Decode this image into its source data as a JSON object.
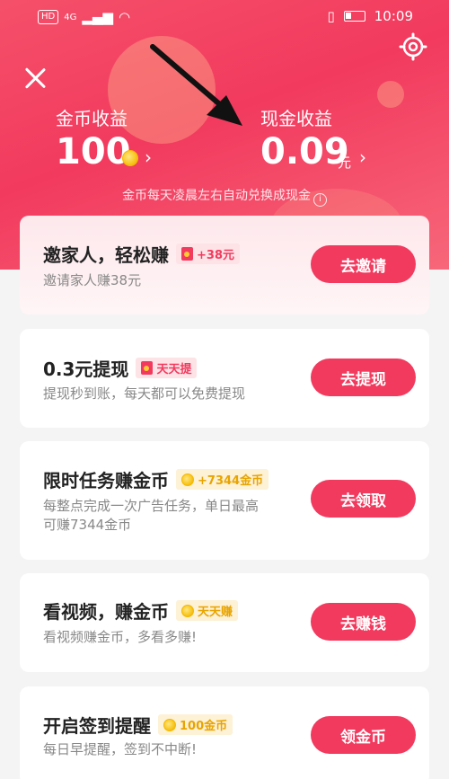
{
  "status_bar": {
    "hd_label": "HD",
    "network_label": "4G",
    "time": "10:09"
  },
  "earnings": {
    "coins_label": "金币收益",
    "coins_value": "100",
    "cash_label": "现金收益",
    "cash_value": "0.09",
    "cash_unit": "元",
    "note": "金币每天凌晨左右自动兑换成现金",
    "info_icon_glyph": "i"
  },
  "tasks": [
    {
      "title": "邀家人，轻松赚",
      "badge": "+38元",
      "badge_style": "red",
      "subtitle": "邀请家人赚38元",
      "button": "去邀请"
    },
    {
      "title": "0.3元提现",
      "badge": "天天提",
      "badge_style": "red",
      "subtitle": "提现秒到账，每天都可以免费提现",
      "button": "去提现"
    },
    {
      "title": "限时任务赚金币",
      "badge": "+7344金币",
      "badge_style": "gold",
      "subtitle_line1": "每整点完成一次广告任务，单日最高",
      "subtitle_line2": "可赚7344金币",
      "button": "去领取"
    },
    {
      "title": "看视频，赚金币",
      "badge": "天天赚",
      "badge_style": "gold",
      "subtitle": "看视频赚金币，多看多赚!",
      "button": "去赚钱"
    },
    {
      "title": "开启签到提醒",
      "badge": "100金币",
      "badge_style": "gold",
      "subtitle": "每日早提醒，签到不中断!",
      "button": "领金币"
    }
  ],
  "colors": {
    "accent": "#f23a5e",
    "gold": "#e8a400"
  },
  "icons": [
    "close-icon",
    "gear-icon",
    "coin-icon",
    "chevron-right-icon",
    "info-icon",
    "red-envelope-icon",
    "wifi-icon",
    "battery-icon"
  ]
}
